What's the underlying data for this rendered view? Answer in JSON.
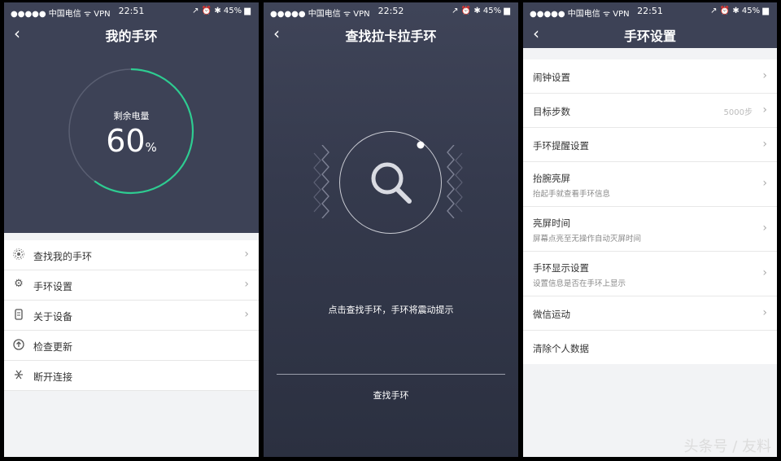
{
  "screen1": {
    "status": {
      "carrier": "●●●●● 中国电信 ᯤ VPN",
      "time": "22:51",
      "right": "↗ ⏰ ✱ 45% ▆"
    },
    "nav": {
      "back": "‹",
      "title": "我的手环"
    },
    "battery": {
      "label": "剩余电量",
      "value": "60",
      "unit": "%",
      "level": 0.6
    },
    "menu": [
      {
        "label": "查找我的手环",
        "icon": "radar-icon"
      },
      {
        "label": "手环设置",
        "icon": "gear-icon"
      },
      {
        "label": "关于设备",
        "icon": "device-icon"
      },
      {
        "label": "检查更新",
        "icon": "update-icon"
      },
      {
        "label": "断开连接",
        "icon": "disconnect-icon"
      }
    ]
  },
  "screen2": {
    "status": {
      "carrier": "●●●●● 中国电信 ᯤ VPN",
      "time": "22:52",
      "right": "↗ ⏰ ✱ 45% ▆"
    },
    "nav": {
      "back": "‹",
      "title": "查找拉卡拉手环"
    },
    "hint": "点击查找手环，手环将震动提示",
    "button": "查找手环"
  },
  "screen3": {
    "status": {
      "carrier": "●●●●● 中国电信 ᯤ VPN",
      "time": "22:51",
      "right": "↗ ⏰ ✱ 45% ▆"
    },
    "nav": {
      "back": "‹",
      "title": "手环设置"
    },
    "items": [
      {
        "label": "闹钟设置",
        "sub": "",
        "value": ""
      },
      {
        "label": "目标步数",
        "sub": "",
        "value": "5000步"
      },
      {
        "label": "手环提醒设置",
        "sub": "",
        "value": ""
      },
      {
        "label": "抬腕亮屏",
        "sub": "抬起手就查看手环信息",
        "value": ""
      },
      {
        "label": "亮屏时间",
        "sub": "屏幕点亮至无操作自动灭屏时间",
        "value": ""
      },
      {
        "label": "手环显示设置",
        "sub": "设置信息是否在手环上显示",
        "value": ""
      },
      {
        "label": "微信运动",
        "sub": "",
        "value": ""
      },
      {
        "label": "清除个人数据",
        "sub": "",
        "value": ""
      }
    ]
  },
  "chevron": "›",
  "watermark": "头条号 / 友料",
  "colors": {
    "accent": "#2ecc91",
    "dark_bg": "#3d4256"
  }
}
